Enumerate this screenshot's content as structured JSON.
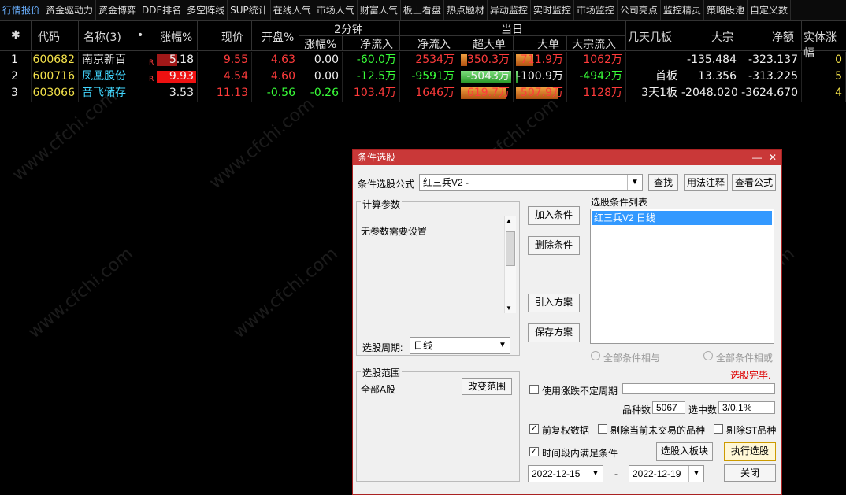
{
  "topnav": [
    "行情报价",
    "资金驱动力",
    "资金博弈",
    "DDE排名",
    "多空阵线",
    "SUP统计",
    "在线人气",
    "市场人气",
    "财富人气",
    "板上看盘",
    "热点题材",
    "异动监控",
    "实时监控",
    "市场监控",
    "公司亮点",
    "监控精灵",
    "策略股池",
    "自定义数"
  ],
  "headers": {
    "sort": "✱",
    "code": "代码",
    "name": "名称(3)",
    "dot": "•",
    "pct": "涨幅%",
    "price": "现价",
    "open": "开盘%",
    "two_min": "2分钟",
    "two_pct": "涨幅%",
    "two_flow": "净流入",
    "today": "当日",
    "flow": "净流入",
    "super": "超大单",
    "big": "大单",
    "block": "大宗流入",
    "boards": "几天几板",
    "dazong": "大宗",
    "jinge": "净额",
    "shiti": "实体涨幅"
  },
  "rows": [
    {
      "no": "1",
      "code": "600682",
      "name": "南京新百",
      "badge": "R",
      "pct": "5.18",
      "pct_fill": 0.52,
      "price": "9.55",
      "open": "4.63",
      "two_pct": "0.00",
      "two_flow": "-60.0万",
      "flow": "2534万",
      "super": "350.3万",
      "super_fill": 0.12,
      "big": "711.9万",
      "big_fill": 0.35,
      "block": "1062万",
      "boards": "",
      "dazong": "-135.484",
      "jinge": "-323.137",
      "shiti": "0"
    },
    {
      "no": "2",
      "code": "600716",
      "name": "凤凰股份",
      "badge": "R",
      "pct": "9.93",
      "pct_fill": 1.0,
      "price": "4.54",
      "open": "4.60",
      "two_pct": "0.00",
      "two_flow": "-12.5万",
      "flow": "-9591万",
      "super": "-5043万",
      "super_fill": 1.0,
      "big": "-100.9万",
      "big_fill": 0.05,
      "block": "-4942万",
      "boards": "首板",
      "dazong": "13.356",
      "jinge": "-313.225",
      "shiti": "5"
    },
    {
      "no": "3",
      "code": "603066",
      "name": "音飞储存",
      "badge": "",
      "pct": "3.53",
      "pct_fill": 0,
      "price": "11.13",
      "open": "-0.56",
      "two_pct": "-0.26",
      "two_flow": "103.4万",
      "flow": "1646万",
      "super": "619.7万",
      "super_fill": 0.9,
      "big": "507.9万",
      "big_fill": 0.85,
      "block": "1128万",
      "boards": "3天1板",
      "dazong": "-2048.020",
      "jinge": "-3624.670",
      "shiti": "4"
    }
  ],
  "watermark": "www.cfchi.com",
  "dialog": {
    "title": "条件选股",
    "formula_label": "条件选股公式",
    "formula_value": "红三兵V2      -",
    "find_btn": "查找",
    "usage_btn": "用法注释",
    "view_btn": "查看公式",
    "calc_params": "计算参数",
    "no_params": "无参数需要设置",
    "add_btn": "加入条件",
    "del_btn": "删除条件",
    "import_btn": "引入方案",
    "save_btn": "保存方案",
    "cond_list_label": "选股条件列表",
    "cond_item": "红三兵V2  日线",
    "period_label": "选股周期:",
    "period_value": "日线",
    "all_and": "全部条件相与",
    "all_or": "全部条件相或",
    "done": "选股完毕.",
    "range_label": "选股范围",
    "range_value": "全部A股",
    "change_range_btn": "改变范围",
    "use_uncertain": "使用涨跌不定周期",
    "count_label": "品种数",
    "count_value": "5067",
    "selected_label": "选中数",
    "selected_value": "3/0.1%",
    "fuquan": "前复权数据",
    "exclude_untraded": "剔除当前未交易的品种",
    "exclude_st": "剔除ST品种",
    "time_cond": "时间段内满足条件",
    "to_block_btn": "选股入板块",
    "run_btn": "执行选股",
    "date_from": "2022-12-15",
    "date_sep": "-",
    "date_to": "2022-12-19",
    "close_btn": "关闭",
    "minimize": "—",
    "close_x": "✕"
  },
  "colors": {
    "accent_red": "#c93838",
    "up": "#ff3b3b",
    "down": "#39ff39",
    "code": "#f4e24a",
    "name_hl": "#42d7ff",
    "select_blue": "#3399ff"
  }
}
